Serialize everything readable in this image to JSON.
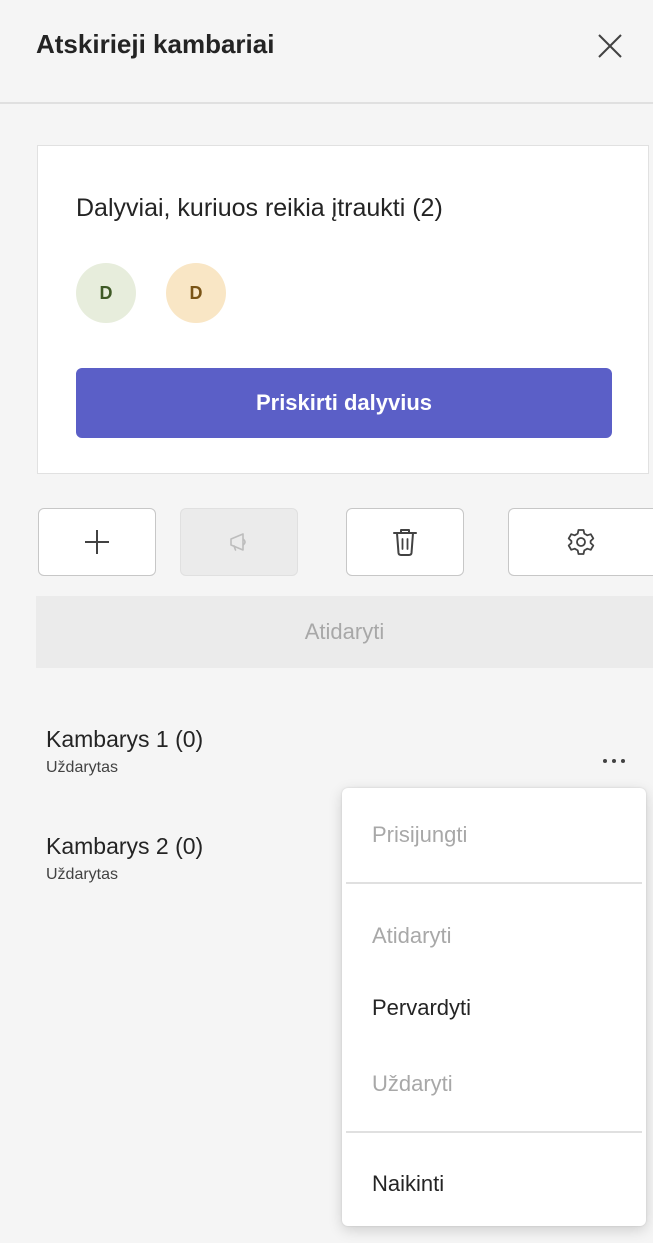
{
  "panel": {
    "title": "Atskirieji kambariai",
    "close_icon": "close-icon"
  },
  "participants_card": {
    "heading": "Dalyviai, kuriuos reikia įtraukti (2)",
    "avatars": [
      {
        "initial": "D",
        "bg_color": "#e7eddc",
        "text_color": "#3f5a26"
      },
      {
        "initial": "D",
        "bg_color": "#f9e6c5",
        "text_color": "#7a5416"
      }
    ],
    "assign_button_label": "Priskirti dalyvius"
  },
  "toolbar": {
    "buttons": [
      {
        "icon": "plus-icon",
        "enabled": true
      },
      {
        "icon": "megaphone-icon",
        "enabled": false
      },
      {
        "icon": "trash-icon",
        "enabled": true
      },
      {
        "icon": "gear-icon",
        "enabled": true
      }
    ]
  },
  "open_button_label": "Atidaryti",
  "rooms": [
    {
      "name": "Kambarys 1 (0)",
      "status": "Uždarytas"
    },
    {
      "name": "Kambarys 2 (0)",
      "status": "Uždarytas"
    }
  ],
  "more_options_icon": "more-horizontal-icon",
  "context_menu": {
    "items": [
      {
        "label": "Prisijungti",
        "enabled": false
      },
      {
        "label": "Atidaryti",
        "enabled": false
      },
      {
        "label": "Pervardyti",
        "enabled": true
      },
      {
        "label": "Uždaryti",
        "enabled": false
      },
      {
        "label": "Naikinti",
        "enabled": true
      }
    ]
  },
  "colors": {
    "accent": "#5b5fc7",
    "panel_bg": "#f5f5f5",
    "card_bg": "#ffffff",
    "disabled_text": "#a8a8a8"
  }
}
